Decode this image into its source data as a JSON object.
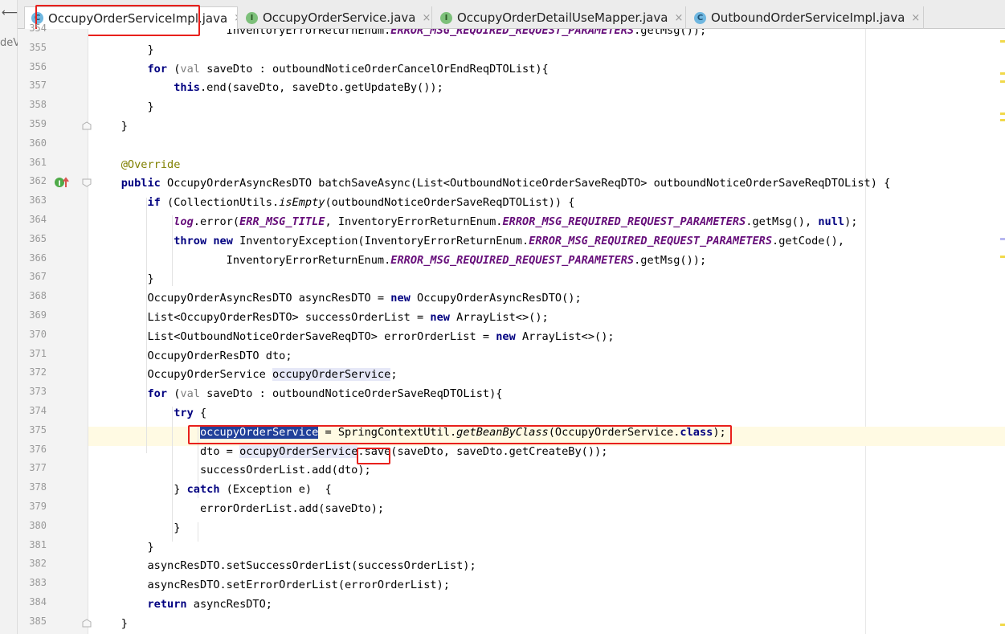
{
  "tabs": [
    {
      "label": "OccupyOrderServiceImpl.java",
      "kind": "class",
      "icon": "class-icon",
      "active": true
    },
    {
      "label": "OccupyOrderService.java",
      "kind": "iface",
      "icon": "interface-icon",
      "active": false
    },
    {
      "label": "OccupyOrderDetailUseMapper.java",
      "kind": "iface",
      "icon": "interface-icon",
      "active": false
    },
    {
      "label": "OutboundOrderServiceImpl.java",
      "kind": "class",
      "icon": "class-icon",
      "active": false
    }
  ],
  "left_strip": {
    "arrow": "⟵",
    "cut_text": "deV"
  },
  "line_numbers": [
    "354",
    "355",
    "356",
    "357",
    "358",
    "359",
    "360",
    "361",
    "362",
    "363",
    "364",
    "365",
    "366",
    "367",
    "368",
    "369",
    "370",
    "371",
    "372",
    "373",
    "374",
    "375",
    "376",
    "377",
    "378",
    "379",
    "380",
    "381",
    "382",
    "383",
    "384",
    "385"
  ],
  "code_lines": [
    [
      {
        "t": "                    InventoryErrorReturnEnum."
      },
      {
        "t": "ERROR_MSG_REQUIRED_REQUEST_PARAMETERS",
        "c": "sf"
      },
      {
        "t": ".getMsg());"
      }
    ],
    [
      {
        "t": "        }"
      }
    ],
    [
      {
        "t": "        "
      },
      {
        "t": "for",
        "c": "kw"
      },
      {
        "t": " ("
      },
      {
        "t": "val",
        "c": "kwl"
      },
      {
        "t": " saveDto : outboundNoticeOrderCancelOrEndReqDTOList){"
      }
    ],
    [
      {
        "t": "            "
      },
      {
        "t": "this",
        "c": "kw"
      },
      {
        "t": ".end(saveDto, saveDto.getUpdateBy());"
      }
    ],
    [
      {
        "t": "        }"
      }
    ],
    [
      {
        "t": "    }"
      }
    ],
    [
      {
        "t": ""
      }
    ],
    [
      {
        "t": "    "
      },
      {
        "t": "@Override",
        "c": "an"
      }
    ],
    [
      {
        "t": "    "
      },
      {
        "t": "public",
        "c": "kw"
      },
      {
        "t": " OccupyOrderAsyncResDTO batchSaveAsync(List<OutboundNoticeOrderSaveReqDTO> outboundNoticeOrderSaveReqDTOList) {"
      }
    ],
    [
      {
        "t": "        "
      },
      {
        "t": "if",
        "c": "kw"
      },
      {
        "t": " (CollectionUtils."
      },
      {
        "t": "isEmpty",
        "c": "sm"
      },
      {
        "t": "(outboundNoticeOrderSaveReqDTOList)) {"
      }
    ],
    [
      {
        "t": "            "
      },
      {
        "t": "log",
        "c": "sf"
      },
      {
        "t": ".error("
      },
      {
        "t": "ERR_MSG_TITLE",
        "c": "sf"
      },
      {
        "t": ", InventoryErrorReturnEnum."
      },
      {
        "t": "ERROR_MSG_REQUIRED_REQUEST_PARAMETERS",
        "c": "sf"
      },
      {
        "t": ".getMsg(), "
      },
      {
        "t": "null",
        "c": "kw"
      },
      {
        "t": ");"
      }
    ],
    [
      {
        "t": "            "
      },
      {
        "t": "throw",
        "c": "kw"
      },
      {
        "t": " "
      },
      {
        "t": "new",
        "c": "kw"
      },
      {
        "t": " InventoryException(InventoryErrorReturnEnum."
      },
      {
        "t": "ERROR_MSG_REQUIRED_REQUEST_PARAMETERS",
        "c": "sf"
      },
      {
        "t": ".getCode(),"
      }
    ],
    [
      {
        "t": "                    InventoryErrorReturnEnum."
      },
      {
        "t": "ERROR_MSG_REQUIRED_REQUEST_PARAMETERS",
        "c": "sf"
      },
      {
        "t": ".getMsg());"
      }
    ],
    [
      {
        "t": "        }"
      }
    ],
    [
      {
        "t": "        OccupyOrderAsyncResDTO asyncResDTO = "
      },
      {
        "t": "new",
        "c": "kw"
      },
      {
        "t": " OccupyOrderAsyncResDTO();"
      }
    ],
    [
      {
        "t": "        List<OccupyOrderResDTO> successOrderList = "
      },
      {
        "t": "new",
        "c": "kw"
      },
      {
        "t": " ArrayList<>();"
      }
    ],
    [
      {
        "t": "        List<OutboundNoticeOrderSaveReqDTO> errorOrderList = "
      },
      {
        "t": "new",
        "c": "kw"
      },
      {
        "t": " ArrayList<>();"
      }
    ],
    [
      {
        "t": "        OccupyOrderResDTO dto;"
      }
    ],
    [
      {
        "t": "        OccupyOrderService "
      },
      {
        "t": "occupyOrderService",
        "c": "ref"
      },
      {
        "t": ";"
      }
    ],
    [
      {
        "t": "        "
      },
      {
        "t": "for",
        "c": "kw"
      },
      {
        "t": " ("
      },
      {
        "t": "val",
        "c": "kwl"
      },
      {
        "t": " saveDto : outboundNoticeOrderSaveReqDTOList){"
      }
    ],
    [
      {
        "t": "            "
      },
      {
        "t": "try",
        "c": "kw"
      },
      {
        "t": " {"
      }
    ],
    [
      {
        "t": "                "
      },
      {
        "t": "occupyOrderService",
        "c": "sel"
      },
      {
        "t": " = SpringContextUtil."
      },
      {
        "t": "getBeanByClass",
        "c": "sm"
      },
      {
        "t": "(OccupyOrderService."
      },
      {
        "t": "class",
        "c": "kw"
      },
      {
        "t": ");"
      }
    ],
    [
      {
        "t": "                dto = "
      },
      {
        "t": "occupyOrderService",
        "c": "ref"
      },
      {
        "t": ".save(saveDto, saveDto.getCreateBy());"
      }
    ],
    [
      {
        "t": "                successOrderList.add(dto);"
      }
    ],
    [
      {
        "t": "            } "
      },
      {
        "t": "catch",
        "c": "kw"
      },
      {
        "t": " (Exception e)  {"
      }
    ],
    [
      {
        "t": "                errorOrderList.add(saveDto);"
      }
    ],
    [
      {
        "t": "            }"
      }
    ],
    [
      {
        "t": "        }"
      }
    ],
    [
      {
        "t": "        asyncResDTO.setSuccessOrderList(successOrderList);"
      }
    ],
    [
      {
        "t": "        asyncResDTO.setErrorOrderList(errorOrderList);"
      }
    ],
    [
      {
        "t": "        "
      },
      {
        "t": "return",
        "c": "kw"
      },
      {
        "t": " asyncResDTO;"
      }
    ],
    [
      {
        "t": "    }"
      }
    ]
  ],
  "gutter_icons": {
    "implements": "implements-icon",
    "override_arrow": "up-arrow-icon",
    "fold": "fold-icon"
  },
  "colors": {
    "keyword": "#000080",
    "static_field": "#660e7a",
    "annotation": "#808000",
    "selection": "#21409a",
    "highlight_box": "#e8201c",
    "caret_line": "#fffae3"
  }
}
